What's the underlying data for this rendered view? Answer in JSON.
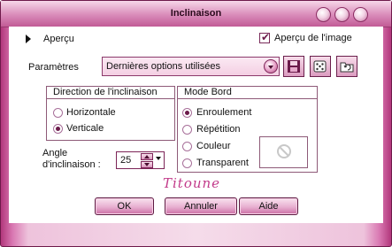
{
  "window": {
    "title": "Inclinaison"
  },
  "preview": {
    "label": "Aperçu"
  },
  "show_preview": {
    "label": "Aperçu de l'image",
    "checked": true
  },
  "params": {
    "label": "Paramètres",
    "selected": "Dernières options utilisées"
  },
  "toolbar": {
    "save_icon": "floppy-disk-icon",
    "random_icon": "dice-icon",
    "reset_icon": "folder-refresh-icon"
  },
  "direction": {
    "title": "Direction de l'inclinaison",
    "options": [
      {
        "label": "Horizontale",
        "checked": false
      },
      {
        "label": "Verticale",
        "checked": true
      }
    ]
  },
  "mode": {
    "title": "Mode Bord",
    "options": [
      {
        "label": "Enroulement",
        "checked": true
      },
      {
        "label": "Répétition",
        "checked": false
      },
      {
        "label": "Couleur",
        "checked": false
      },
      {
        "label": "Transparent",
        "checked": false
      }
    ]
  },
  "angle": {
    "label_line1": "Angle",
    "label_line2": "d'inclinaison :",
    "value": "25"
  },
  "signature": "Titoune",
  "buttons": {
    "ok": "OK",
    "cancel": "Annuler",
    "help": "Aide"
  },
  "colors": {
    "accent": "#c25b96",
    "dark": "#6b1a4a",
    "frame": "#b2377c"
  }
}
